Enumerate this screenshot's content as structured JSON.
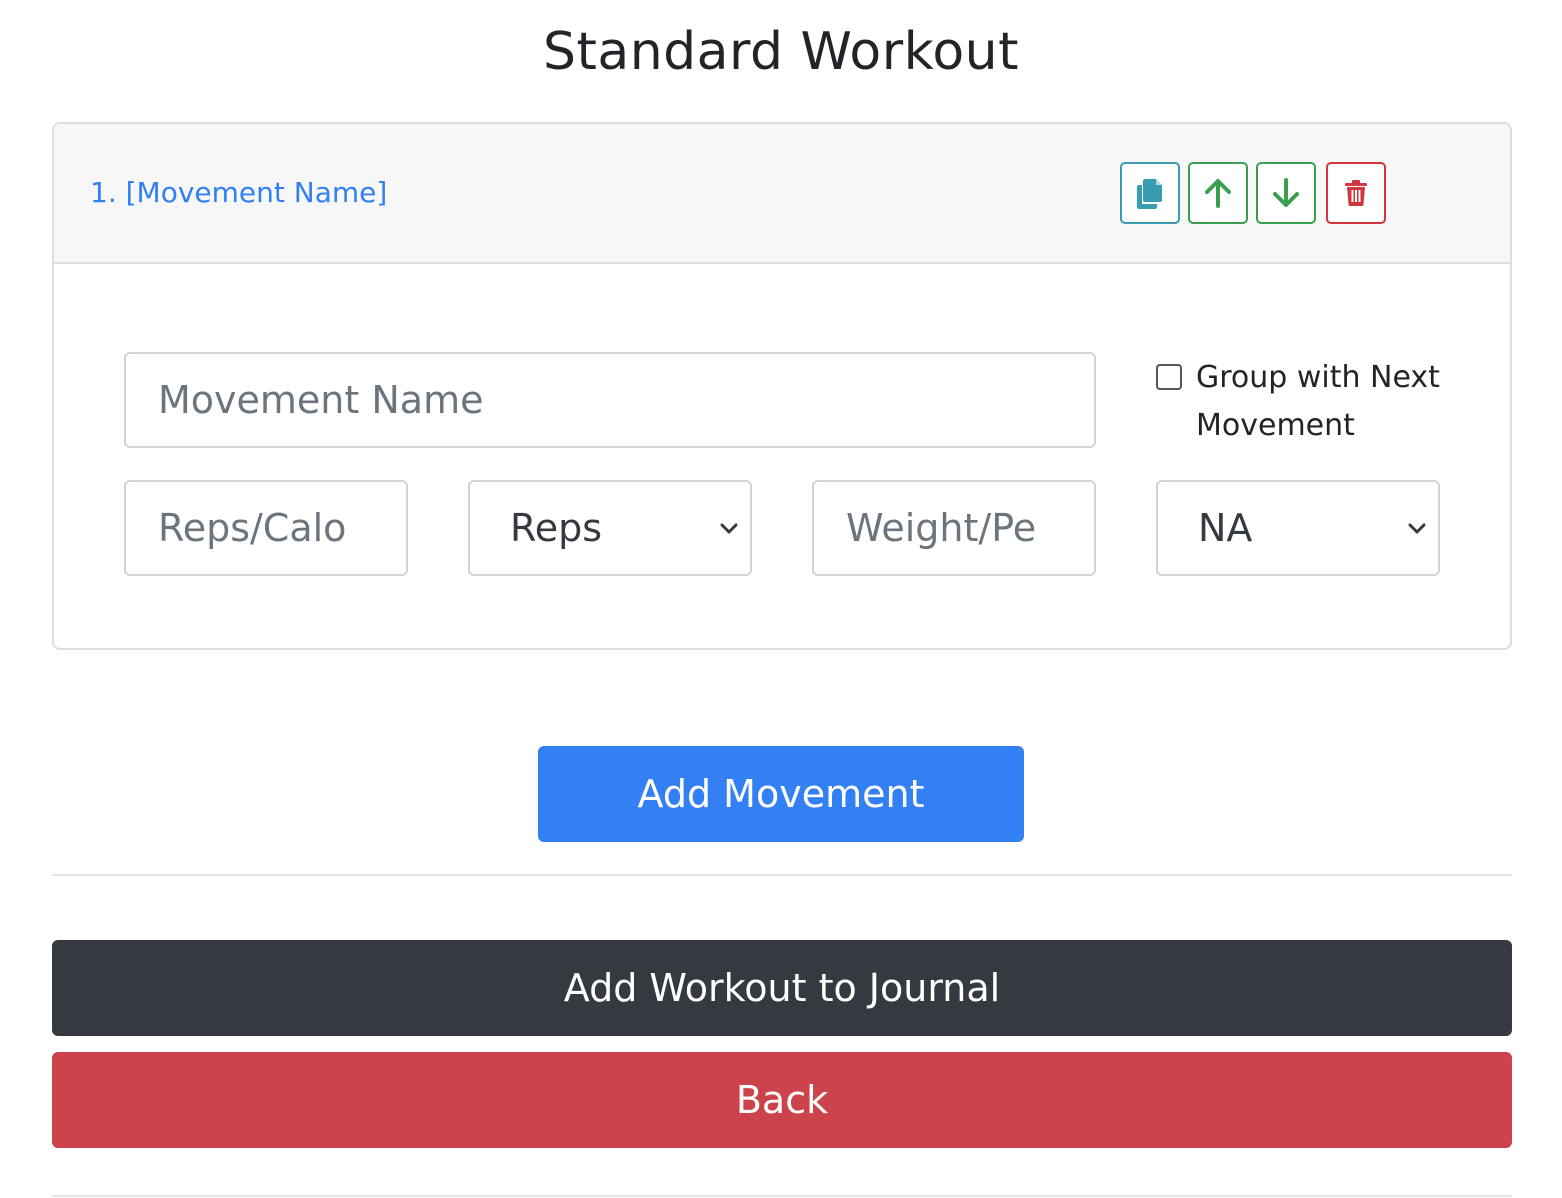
{
  "page": {
    "title": "Standard Workout"
  },
  "movement_card": {
    "header_link": "1. [Movement Name]",
    "buttons": {
      "copy_icon": "copy-icon",
      "up_icon": "arrow-up-icon",
      "down_icon": "arrow-down-icon",
      "delete_icon": "trash-icon"
    },
    "name_field": {
      "placeholder": "Movement Name",
      "value": ""
    },
    "group_checkbox": {
      "label": "Group with Next Movement",
      "checked": false
    },
    "reps_field": {
      "placeholder": "Reps/Calo",
      "value": ""
    },
    "unit_select": {
      "selected": "Reps"
    },
    "weight_field": {
      "placeholder": "Weight/Pe",
      "value": ""
    },
    "weight_unit_select": {
      "selected": "NA"
    }
  },
  "actions": {
    "add_movement": "Add Movement",
    "add_to_journal": "Add Workout to Journal",
    "back": "Back"
  },
  "colors": {
    "primary": "#3280f3",
    "dark": "#343a40",
    "danger": "#cc434b",
    "success": "#3a9f4e",
    "info": "#3a9cb0"
  }
}
